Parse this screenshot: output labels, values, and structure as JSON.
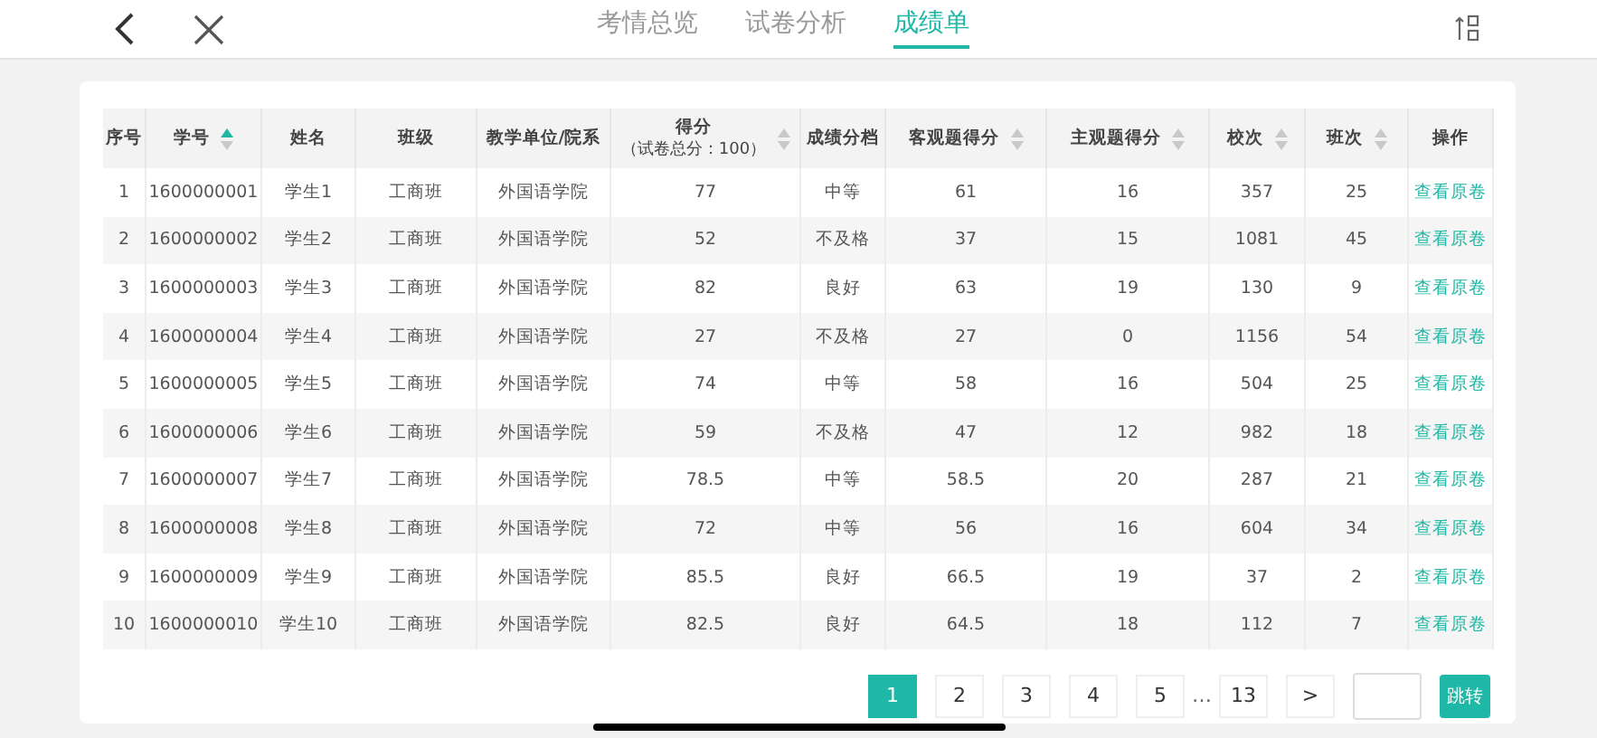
{
  "tabs": [
    {
      "label": "考情总览",
      "selected": false
    },
    {
      "label": "试卷分析",
      "selected": false
    },
    {
      "label": "成绩单",
      "selected": true
    }
  ],
  "table": {
    "columns": [
      {
        "label": "序号"
      },
      {
        "label": "学号",
        "sorted": true
      },
      {
        "label": "姓名"
      },
      {
        "label": "班级"
      },
      {
        "label": "教学单位/院系"
      },
      {
        "label": "得分",
        "sub": "（试卷总分：100）",
        "sorted": false
      },
      {
        "label": "成绩分档"
      },
      {
        "label": "客观题得分",
        "sorted": false
      },
      {
        "label": "主观题得分",
        "sorted": false
      },
      {
        "label": "校次",
        "sorted": false
      },
      {
        "label": "班次",
        "sorted": false
      },
      {
        "label": "操作"
      }
    ],
    "rows": [
      [
        "1",
        "1600000001",
        "学生1",
        "工商班",
        "外国语学院",
        "77",
        "中等",
        "61",
        "16",
        "357",
        "25",
        "查看原卷"
      ],
      [
        "2",
        "1600000002",
        "学生2",
        "工商班",
        "外国语学院",
        "52",
        "不及格",
        "37",
        "15",
        "1081",
        "45",
        "查看原卷"
      ],
      [
        "3",
        "1600000003",
        "学生3",
        "工商班",
        "外国语学院",
        "82",
        "良好",
        "63",
        "19",
        "130",
        "9",
        "查看原卷"
      ],
      [
        "4",
        "1600000004",
        "学生4",
        "工商班",
        "外国语学院",
        "27",
        "不及格",
        "27",
        "0",
        "1156",
        "54",
        "查看原卷"
      ],
      [
        "5",
        "1600000005",
        "学生5",
        "工商班",
        "外国语学院",
        "74",
        "中等",
        "58",
        "16",
        "504",
        "25",
        "查看原卷"
      ],
      [
        "6",
        "1600000006",
        "学生6",
        "工商班",
        "外国语学院",
        "59",
        "不及格",
        "47",
        "12",
        "982",
        "18",
        "查看原卷"
      ],
      [
        "7",
        "1600000007",
        "学生7",
        "工商班",
        "外国语学院",
        "78.5",
        "中等",
        "58.5",
        "20",
        "287",
        "21",
        "查看原卷"
      ],
      [
        "8",
        "1600000008",
        "学生8",
        "工商班",
        "外国语学院",
        "72",
        "中等",
        "56",
        "16",
        "604",
        "34",
        "查看原卷"
      ],
      [
        "9",
        "1600000009",
        "学生9",
        "工商班",
        "外国语学院",
        "85.5",
        "良好",
        "66.5",
        "19",
        "37",
        "2",
        "查看原卷"
      ],
      [
        "10",
        "1600000010",
        "学生10",
        "工商班",
        "外国语学院",
        "82.5",
        "良好",
        "64.5",
        "18",
        "112",
        "7",
        "查看原卷"
      ]
    ]
  },
  "pagination": {
    "pages": [
      {
        "label": "1",
        "selected": true
      },
      {
        "label": "2",
        "selected": false
      },
      {
        "label": "3",
        "selected": false
      },
      {
        "label": "4",
        "selected": false
      },
      {
        "label": "5",
        "selected": false
      },
      {
        "label": "…",
        "kind": "ellipsis"
      },
      {
        "label": "13",
        "selected": false
      }
    ],
    "next": ">",
    "jump": "跳转"
  }
}
